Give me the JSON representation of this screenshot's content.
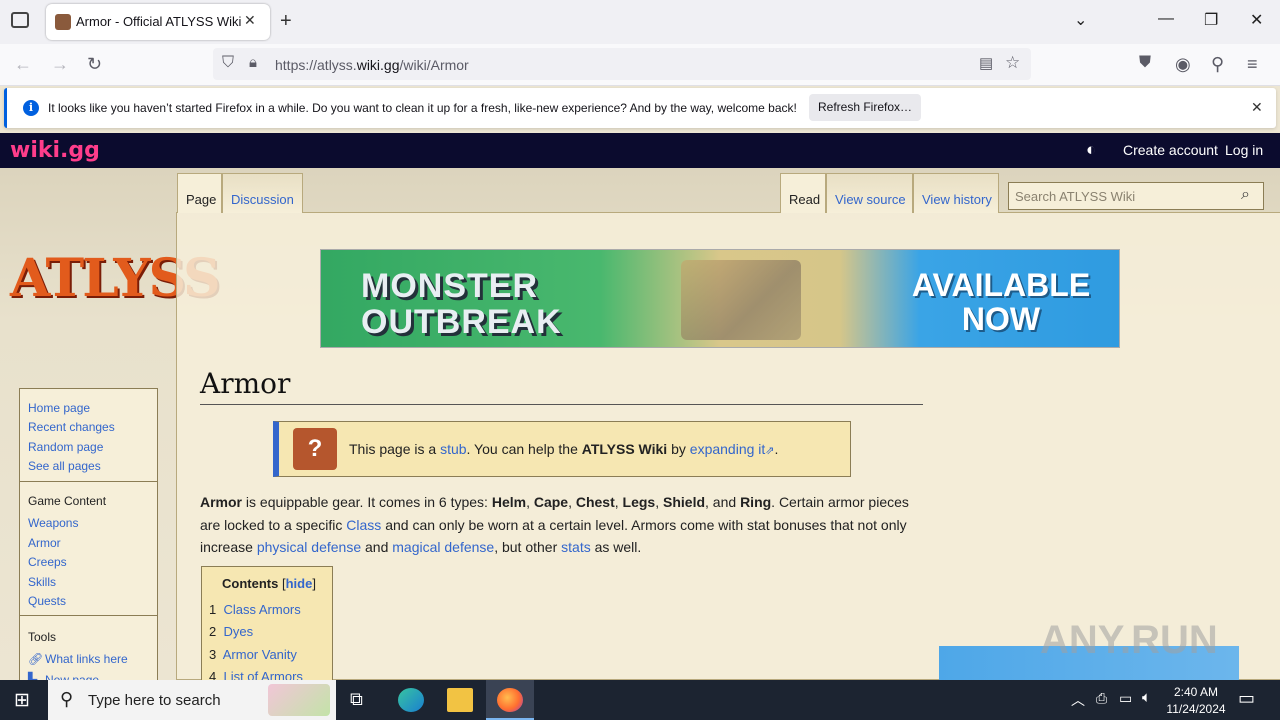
{
  "browser": {
    "tab_title": "Armor - Official ATLYSS Wiki",
    "url_prefix": "https://atlyss.",
    "url_domain": "wiki.gg",
    "url_path": "/wiki/Armor"
  },
  "notification": {
    "message": "It looks like you haven’t started Firefox in a while. Do you want to clean it up for a fresh, like-new experience? And by the way, welcome back!",
    "button": "Refresh Firefox…"
  },
  "site_header": {
    "logo": "wiki.gg",
    "create_account": "Create account",
    "login": "Log in"
  },
  "site_logo": "ATLYSS",
  "sidebar": {
    "nav": [
      "Home page",
      "Recent changes",
      "Random page",
      "See all pages"
    ],
    "game_heading": "Game Content",
    "game": [
      "Weapons",
      "Armor",
      "Creeps",
      "Skills",
      "Quests"
    ],
    "tools_heading": "Tools",
    "tools": [
      "What links here",
      "New page"
    ]
  },
  "page_tabs": {
    "page": "Page",
    "discussion": "Discussion",
    "read": "Read",
    "view_source": "View source",
    "view_history": "View history"
  },
  "search": {
    "placeholder": "Search ATLYSS Wiki"
  },
  "banner": {
    "left_text": "MONSTER OUTBREAK",
    "right_text": "AVAILABLE NOW"
  },
  "article": {
    "title": "Armor",
    "stub": {
      "t1": "This page is a ",
      "link1": "stub",
      "t2": ". You can help the ",
      "bold": "ATLYSS Wiki",
      "t3": " by ",
      "link2": "expanding it",
      "t4": "."
    },
    "intro": {
      "b1": "Armor",
      "t1": " is equippable gear. It comes in 6 types: ",
      "helm": "Helm",
      "cape": "Cape",
      "chest": "Chest",
      "legs": "Legs",
      "shield": "Shield",
      "and": ", and ",
      "ring": "Ring",
      "t2": ". Certain armor pieces are locked to a specific ",
      "class": "Class",
      "t3": " and can only be worn at a certain level. Armors come with stat bonuses that not only increase ",
      "pdef": "physical defense",
      "t4": " and ",
      "mdef": "magical defense",
      "t5": ", but other ",
      "stats": "stats",
      "t6": " as well."
    },
    "toc": {
      "title": "Contents",
      "hide": "hide",
      "items": [
        {
          "num": "1",
          "label": "Class Armors"
        },
        {
          "num": "2",
          "label": "Dyes"
        },
        {
          "num": "3",
          "label": "Armor Vanity"
        },
        {
          "num": "4",
          "label": "List of Armors"
        }
      ]
    }
  },
  "watermark": "ANY.RUN",
  "taskbar": {
    "search_placeholder": "Type here to search",
    "time": "2:40 AM",
    "date": "11/24/2024"
  }
}
